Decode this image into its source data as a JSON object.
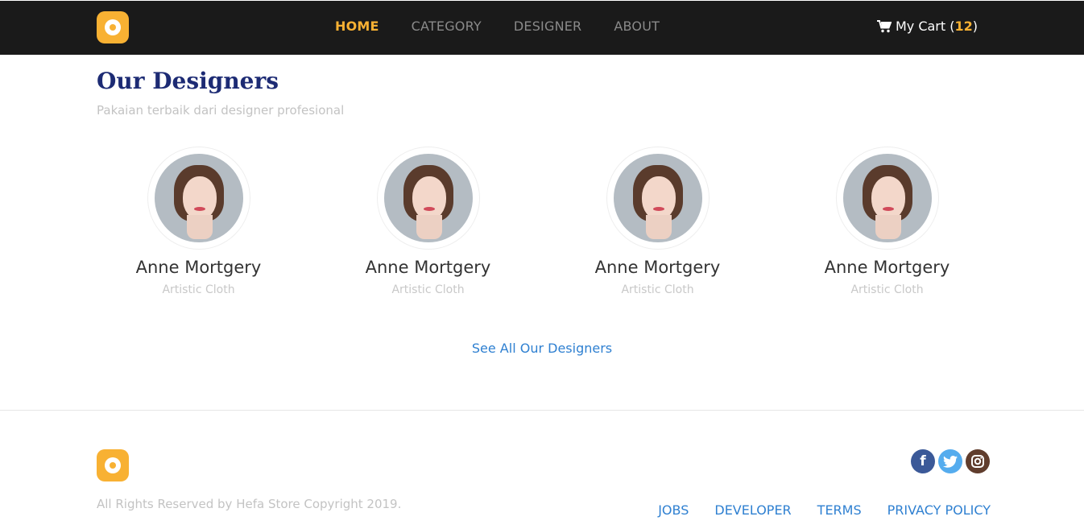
{
  "nav": {
    "logo": "logo-icon",
    "links": [
      "HOME",
      "CATEGORY",
      "DESIGNER",
      "ABOUT"
    ],
    "active": "HOME",
    "cart_label": "My Cart",
    "cart_count": "12"
  },
  "section": {
    "title": "Our Designers",
    "subtitle": "Pakaian terbaik dari designer profesional"
  },
  "designers": [
    {
      "name": "Anne Mortgery",
      "role": "Artistic Cloth"
    },
    {
      "name": "Anne Mortgery",
      "role": "Artistic Cloth"
    },
    {
      "name": "Anne Mortgery",
      "role": "Artistic Cloth"
    },
    {
      "name": "Anne Mortgery",
      "role": "Artistic Cloth"
    }
  ],
  "see_all": "See All Our Designers",
  "footer": {
    "copyright": "All Rights Reserved by Hefa Store Copyright 2019.",
    "social": [
      "facebook-icon",
      "twitter-icon",
      "instagram-icon"
    ],
    "links": [
      "JOBS",
      "DEVELOPER",
      "TERMS",
      "PRIVACY POLICY"
    ]
  },
  "colors": {
    "accent": "#f8b133",
    "nav_bg": "#1a1a1a",
    "title": "#1d2b74",
    "link": "#2f80d1"
  }
}
